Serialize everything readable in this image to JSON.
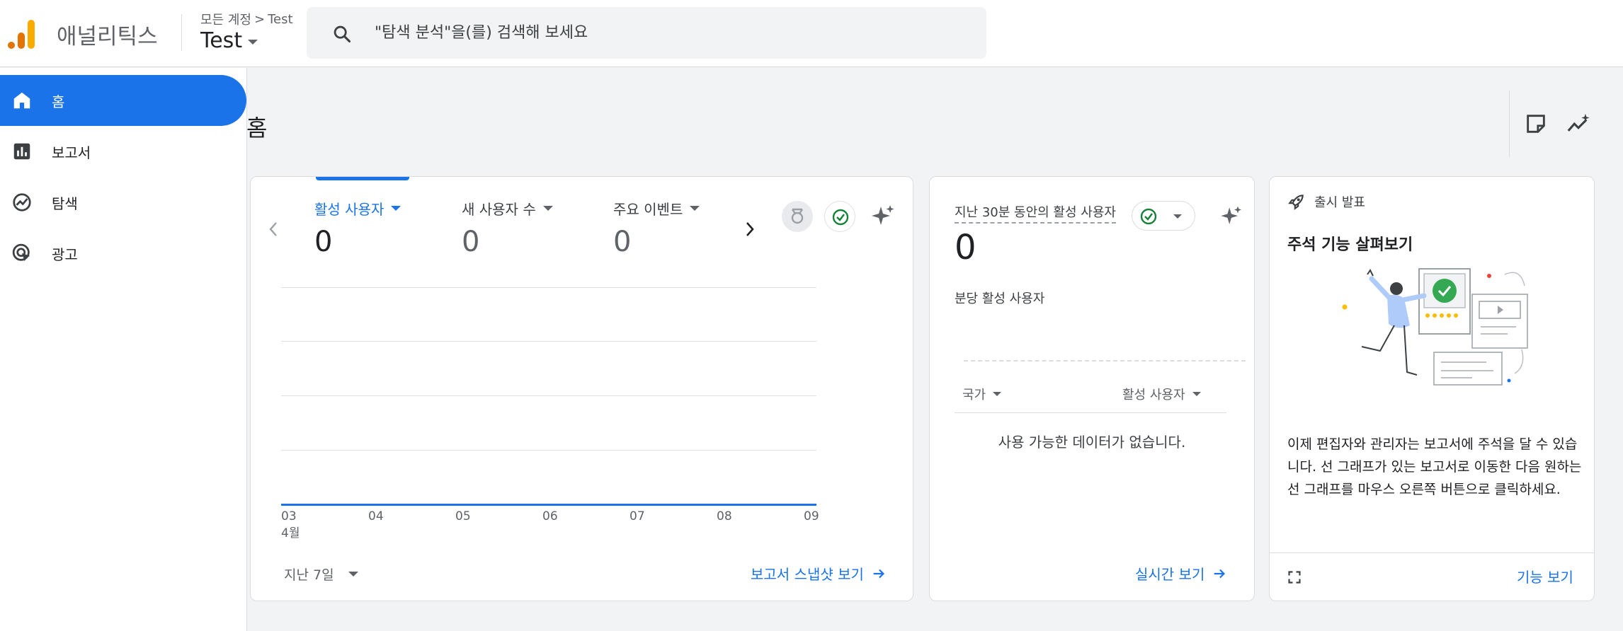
{
  "header": {
    "app_name": "애널리틱스",
    "breadcrumb_parent": "모든 계정",
    "breadcrumb_separator": ">",
    "breadcrumb_child": "Test",
    "account_name": "Test",
    "search_placeholder": "\"탐색 분석\"을(를) 검색해 보세요",
    "logo_colors": [
      "#e37400",
      "#f9ab00"
    ]
  },
  "sidebar": {
    "items": [
      {
        "label": "홈",
        "icon": "home-icon",
        "active": true
      },
      {
        "label": "보고서",
        "icon": "bar-chart-icon",
        "active": false
      },
      {
        "label": "탐색",
        "icon": "explore-icon",
        "active": false
      },
      {
        "label": "광고",
        "icon": "advertising-icon",
        "active": false
      }
    ]
  },
  "page": {
    "title": "홈"
  },
  "overview_card": {
    "metrics": [
      {
        "label": "활성 사용자",
        "value": "0",
        "active": true
      },
      {
        "label": "새 사용자 수",
        "value": "0",
        "active": false
      },
      {
        "label": "주요 이벤트",
        "value": "0",
        "active": false
      }
    ],
    "date_range": "지난 7일",
    "link": "보고서 스냅샷 보기"
  },
  "chart_data": {
    "type": "line",
    "categories": [
      "03",
      "04",
      "05",
      "06",
      "07",
      "08",
      "09"
    ],
    "x_month_label": "4월",
    "series": [
      {
        "values": [
          0,
          0,
          0,
          0,
          0,
          0,
          0
        ]
      }
    ],
    "grid": true,
    "accent": "#1a73e8"
  },
  "realtime_card": {
    "title": "지난 30분 동안의 활성 사용자",
    "value": "0",
    "subtitle": "분당 활성 사용자",
    "col_country": "국가",
    "col_active_users": "활성 사용자",
    "no_data": "사용 가능한 데이터가 없습니다.",
    "link": "실시간 보기"
  },
  "release_card": {
    "header": "출시 발표",
    "title": "주석 기능 살펴보기",
    "description": "이제 편집자와 관리자는 보고서에 주석을 달 수 있습니다. 선 그래프가 있는 보고서로 이동한 다음 원하는 선 그래프를 마우스 오른쪽 버튼으로 클릭하세요.",
    "link": "기능 보기"
  },
  "colors": {
    "accent": "#1a73e8",
    "success": "#188038",
    "text": "#202124"
  }
}
